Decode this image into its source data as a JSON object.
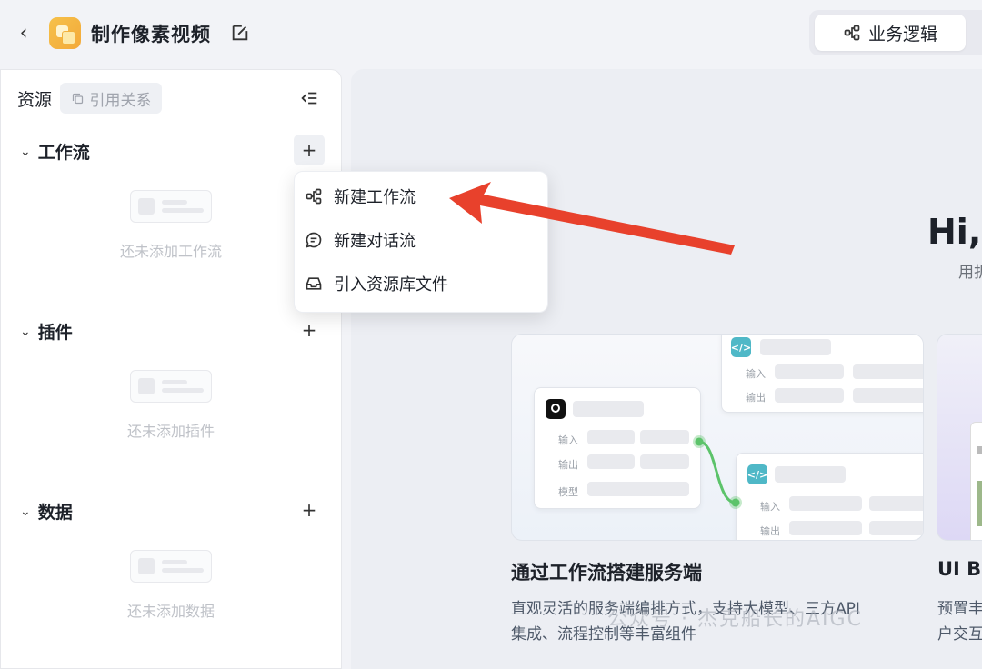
{
  "header": {
    "title": "制作像素视频",
    "business_logic_label": "业务逻辑"
  },
  "sidebar": {
    "title": "资源",
    "reference_label": "引用关系",
    "sections": [
      {
        "title": "工作流",
        "empty_text": "还未添加工作流"
      },
      {
        "title": "插件",
        "empty_text": "还未添加插件"
      },
      {
        "title": "数据",
        "empty_text": "还未添加数据"
      }
    ]
  },
  "menu": {
    "items": [
      {
        "label": "新建工作流",
        "icon": "workflow-icon"
      },
      {
        "label": "新建对话流",
        "icon": "chat-icon"
      },
      {
        "label": "引入资源库文件",
        "icon": "inbox-icon"
      }
    ]
  },
  "main": {
    "greeting": "Hi,",
    "greeting_sub": "用折",
    "cards": [
      {
        "title": "通过工作流搭建服务端",
        "desc_line1": "直观灵活的服务端编排方式，支持大模型、三方API",
        "desc_line2": "集成、流程控制等丰富组件",
        "node_labels": {
          "input": "输入",
          "output": "输出",
          "model": "模型"
        }
      },
      {
        "title": "UI Bu",
        "desc_line1": "预置丰",
        "desc_line2": "户交互"
      }
    ]
  },
  "watermark": "公众号 · 杰克船长的AIGC",
  "colors": {
    "accent_arrow": "#e8412c",
    "connector_green": "#5cc36a",
    "code_icon": "#4fb8c7"
  }
}
